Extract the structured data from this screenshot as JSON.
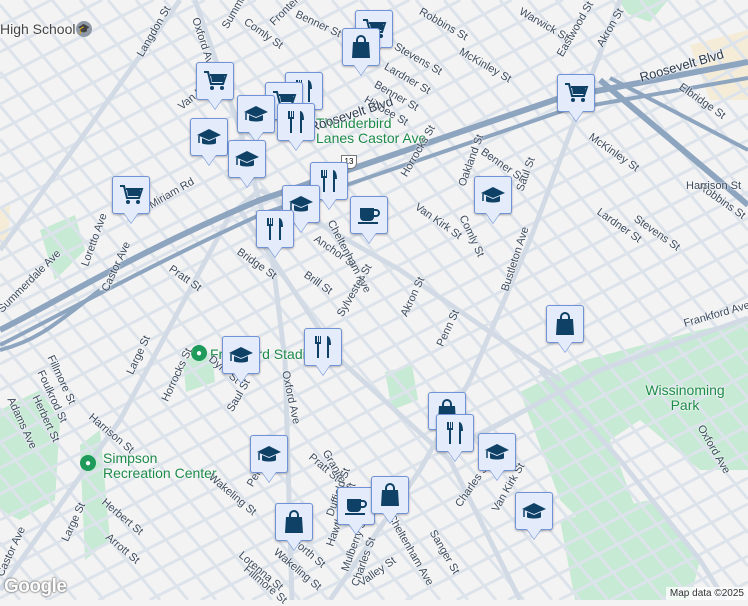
{
  "map": {
    "attribution": "Map data ©2025",
    "logo": "Google",
    "colors": {
      "background": "#f4f3f3",
      "road": "#d6dee8",
      "highway": "#8ea5c0",
      "park": "#c6ead3",
      "marker_bg": "#e4ecfc",
      "marker_border": "#6f92d8",
      "icon": "#0f4167",
      "poi_text": "#1e8a4a"
    }
  },
  "pois": {
    "high_school": "High School",
    "thunderbird": "Thunderbird Lanes Castor Ave",
    "frankford_stadium": "Frankford Stadium",
    "simpson": "Simpson Recreation Center",
    "wissinoming": "Wissinoming Park"
  },
  "highway_shield": "13",
  "streets": [
    "Langdon St",
    "Oxford Ave",
    "Summerdale Ave",
    "Comly St",
    "Frontenac St",
    "Benner St",
    "Stevens St",
    "Lardner St",
    "Benner St",
    "Higbee St",
    "McKinley St",
    "Robbins St",
    "Warwick St",
    "Eastwood St",
    "Akron St",
    "Roosevelt Blvd",
    "Roosevelt Blvd",
    "Elbridge St",
    "McKinley St",
    "Robbins St",
    "Benner St",
    "Horrocks St",
    "Oakland St",
    "Saul St",
    "Van Kirk St",
    "Bustleton Ave",
    "Lardner St",
    "Stevens St",
    "Miriam Rd",
    "Loretto Ave",
    "Summerdale Ave",
    "Pratt St",
    "Bridge St",
    "Anchor St",
    "Brill St",
    "Cheltenham Ave",
    "Sylvester St",
    "Akron St",
    "Penn St",
    "Castor Ave",
    "Fillmore St",
    "Foulkrod St",
    "Herbert St",
    "Adams Ave",
    "Harrison St",
    "Large St",
    "Horrocks St",
    "Oxford Ave",
    "Dyre St",
    "Saul St",
    "Wakeling St",
    "Penn St",
    "Arrott St",
    "Herbert St",
    "Large St",
    "Castor Ave",
    "Haworth St",
    "Wakeling St",
    "Pratt St",
    "Granite St",
    "Duffield St",
    "Hawthorne St",
    "Mulberry St",
    "Charles St",
    "Valley St",
    "Sanger St",
    "E Cheltenham Ave",
    "Charles St",
    "Van Kirk St",
    "Comly St",
    "Frankford Ave",
    "Oxford Ave",
    "Harrison St",
    "Fillmore St",
    "Lorenna St",
    "Van Kirk St"
  ],
  "markers": [
    {
      "type": "shopping-cart"
    },
    {
      "type": "shopping-bag"
    },
    {
      "type": "shopping-cart"
    },
    {
      "type": "restaurant"
    },
    {
      "type": "shopping-cart"
    },
    {
      "type": "education"
    },
    {
      "type": "restaurant"
    },
    {
      "type": "education"
    },
    {
      "type": "education"
    },
    {
      "type": "restaurant"
    },
    {
      "type": "education"
    },
    {
      "type": "restaurant"
    },
    {
      "type": "coffee"
    },
    {
      "type": "shopping-cart"
    },
    {
      "type": "shopping-cart"
    },
    {
      "type": "education"
    },
    {
      "type": "shopping-bag"
    },
    {
      "type": "restaurant"
    },
    {
      "type": "education"
    },
    {
      "type": "shopping-bag"
    },
    {
      "type": "restaurant"
    },
    {
      "type": "education"
    },
    {
      "type": "education"
    },
    {
      "type": "shopping-bag"
    },
    {
      "type": "coffee"
    },
    {
      "type": "shopping-bag"
    },
    {
      "type": "education"
    }
  ]
}
